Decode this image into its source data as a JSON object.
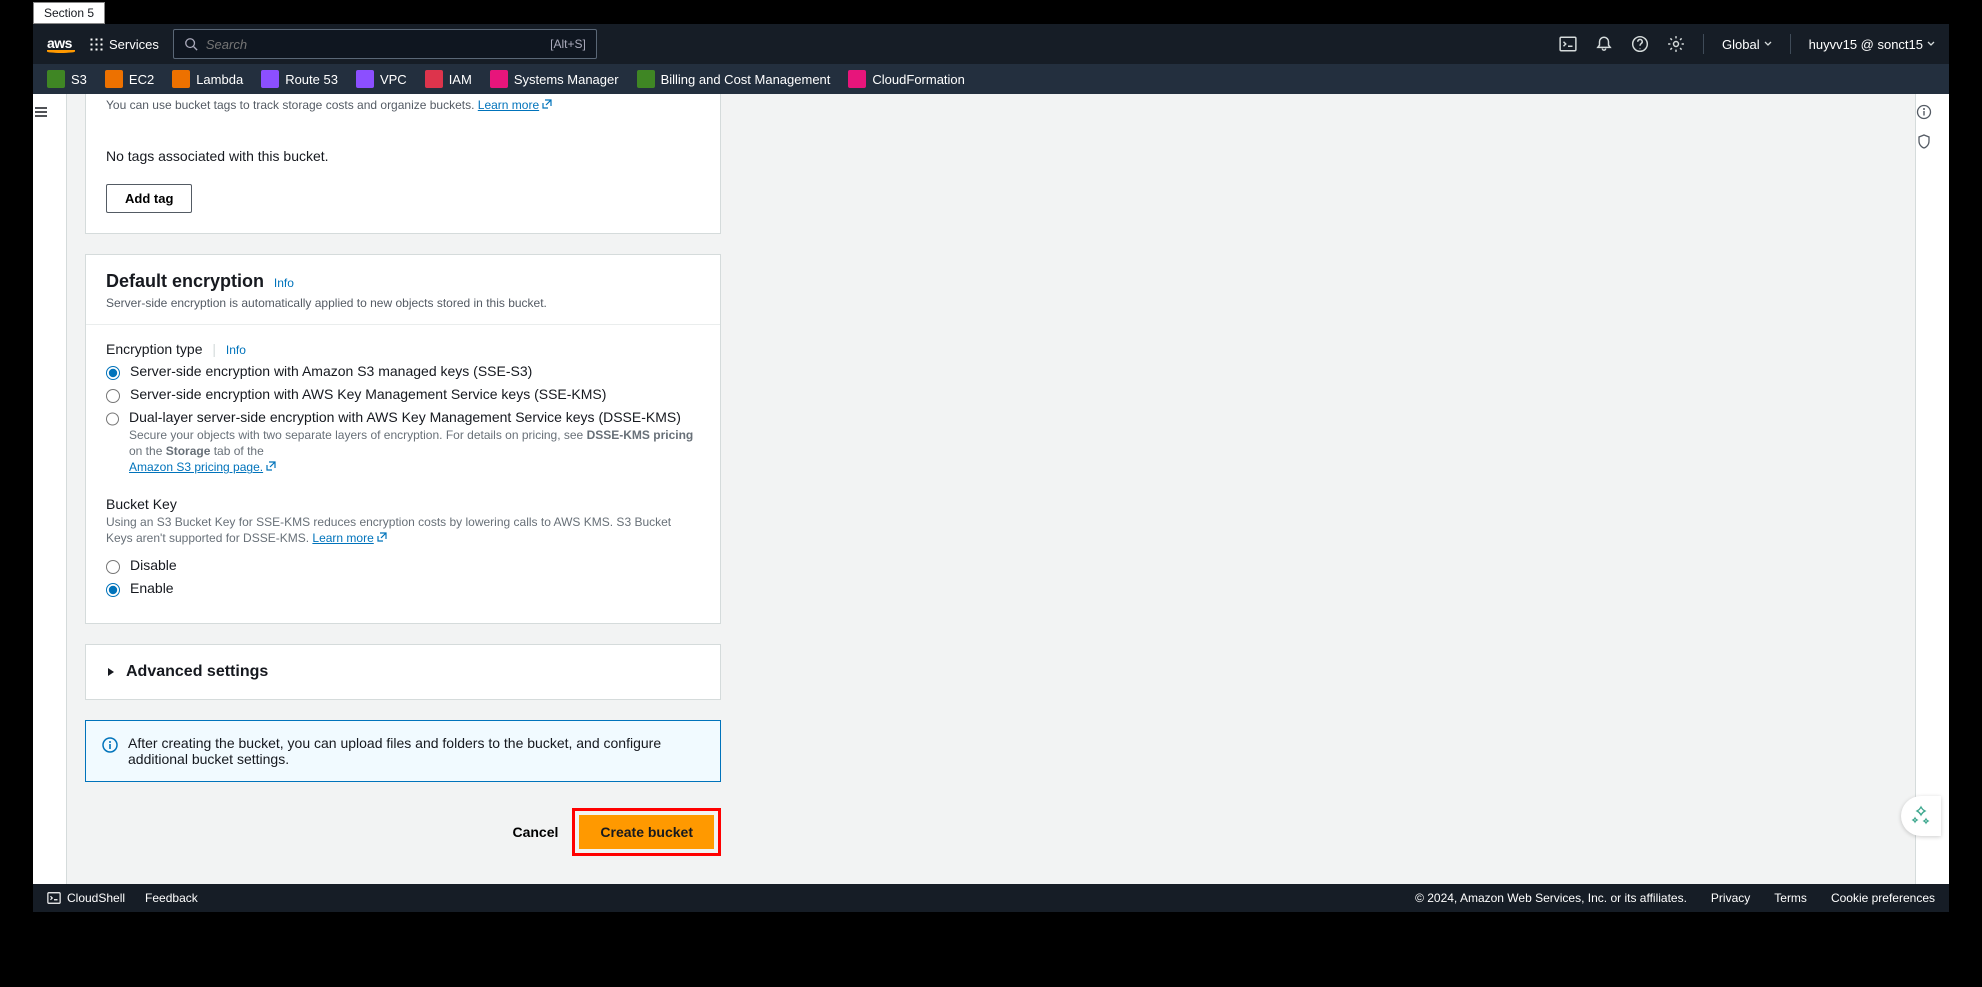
{
  "section_tab": "Section 5",
  "topnav": {
    "logo": "aws",
    "services": "Services",
    "search_placeholder": "Search",
    "search_hint": "[Alt+S]",
    "region": "Global",
    "user": "huyvv15 @ sonct15"
  },
  "subnav": [
    {
      "label": "S3",
      "color": "#3f8624"
    },
    {
      "label": "EC2",
      "color": "#ed7100"
    },
    {
      "label": "Lambda",
      "color": "#ed7100"
    },
    {
      "label": "Route 53",
      "color": "#8c4fff"
    },
    {
      "label": "VPC",
      "color": "#8c4fff"
    },
    {
      "label": "IAM",
      "color": "#dd344c"
    },
    {
      "label": "Systems Manager",
      "color": "#e7157b"
    },
    {
      "label": "Billing and Cost Management",
      "color": "#3f8624"
    },
    {
      "label": "CloudFormation",
      "color": "#e7157b"
    }
  ],
  "tags": {
    "hint_prefix": "You can use bucket tags to track storage costs and organize buckets. ",
    "learn_more": "Learn more",
    "empty": "No tags associated with this bucket.",
    "add_btn": "Add tag"
  },
  "encryption": {
    "title": "Default encryption",
    "info": "Info",
    "desc": "Server-side encryption is automatically applied to new objects stored in this bucket.",
    "type_label": "Encryption type",
    "type_info": "Info",
    "options": [
      {
        "label": "Server-side encryption with Amazon S3 managed keys (SSE-S3)"
      },
      {
        "label": "Server-side encryption with AWS Key Management Service keys (SSE-KMS)"
      },
      {
        "label": "Dual-layer server-side encryption with AWS Key Management Service keys (DSSE-KMS)"
      }
    ],
    "dsse_desc_a": "Secure your objects with two separate layers of encryption. For details on pricing, see ",
    "dsse_desc_b": "DSSE-KMS pricing",
    "dsse_desc_c": " on the ",
    "dsse_desc_d": "Storage",
    "dsse_desc_e": " tab of the ",
    "dsse_link": "Amazon S3 pricing page.",
    "bucket_key_label": "Bucket Key",
    "bucket_key_desc_a": "Using an S3 Bucket Key for SSE-KMS reduces encryption costs by lowering calls to AWS KMS. S3 Bucket Keys aren't supported for DSSE-KMS. ",
    "bucket_key_learn": "Learn more",
    "bk_options": [
      {
        "label": "Disable"
      },
      {
        "label": "Enable"
      }
    ]
  },
  "advanced": {
    "title": "Advanced settings"
  },
  "info_banner": "After creating the bucket, you can upload files and folders to the bucket, and configure additional bucket settings.",
  "actions": {
    "cancel": "Cancel",
    "create": "Create bucket"
  },
  "footer": {
    "cloudshell": "CloudShell",
    "feedback": "Feedback",
    "copyright": "© 2024, Amazon Web Services, Inc. or its affiliates.",
    "privacy": "Privacy",
    "terms": "Terms",
    "cookies": "Cookie preferences"
  }
}
